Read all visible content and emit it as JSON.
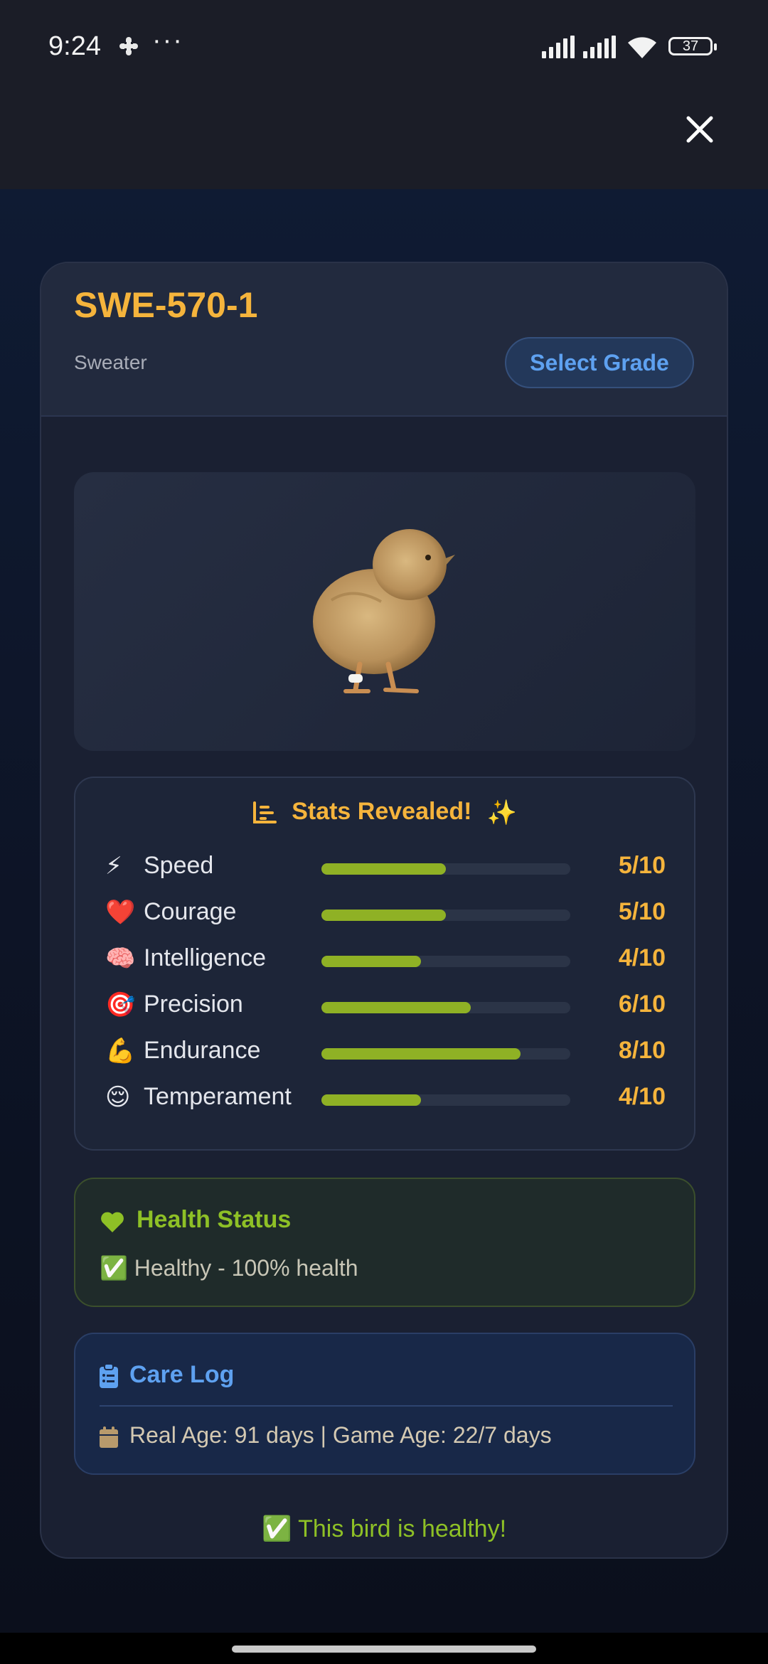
{
  "status_bar": {
    "time": "9:24",
    "more": "···",
    "battery": "37"
  },
  "bird": {
    "id": "SWE-570-1",
    "type": "Sweater",
    "grade_button": "Select Grade"
  },
  "stats": {
    "title": "Stats Revealed!",
    "items": [
      {
        "emoji": "⚡",
        "name": "Speed",
        "value": "5/10",
        "level": 5
      },
      {
        "emoji": "❤️",
        "name": "Courage",
        "value": "5/10",
        "level": 5
      },
      {
        "emoji": "🧠",
        "name": "Intelligence",
        "value": "4/10",
        "level": 4
      },
      {
        "emoji": "🎯",
        "name": "Precision",
        "value": "6/10",
        "level": 6
      },
      {
        "emoji": "💪",
        "name": "Endurance",
        "value": "8/10",
        "level": 8
      },
      {
        "emoji": "😌",
        "name": "Temperament",
        "value": "4/10",
        "level": 4
      }
    ],
    "max": 10
  },
  "health": {
    "title": "Health Status",
    "status": "✅ Healthy - 100% health"
  },
  "care_log": {
    "title": "Care Log",
    "age_line": "Real Age: 91 days | Game Age: 22/7 days"
  },
  "footer": {
    "message": "✅ This bird is healthy!"
  },
  "colors": {
    "accent_gold": "#f5b43c",
    "accent_blue": "#5ea1f0",
    "accent_green": "#8ec026",
    "bar_fill": "#8fb125"
  }
}
